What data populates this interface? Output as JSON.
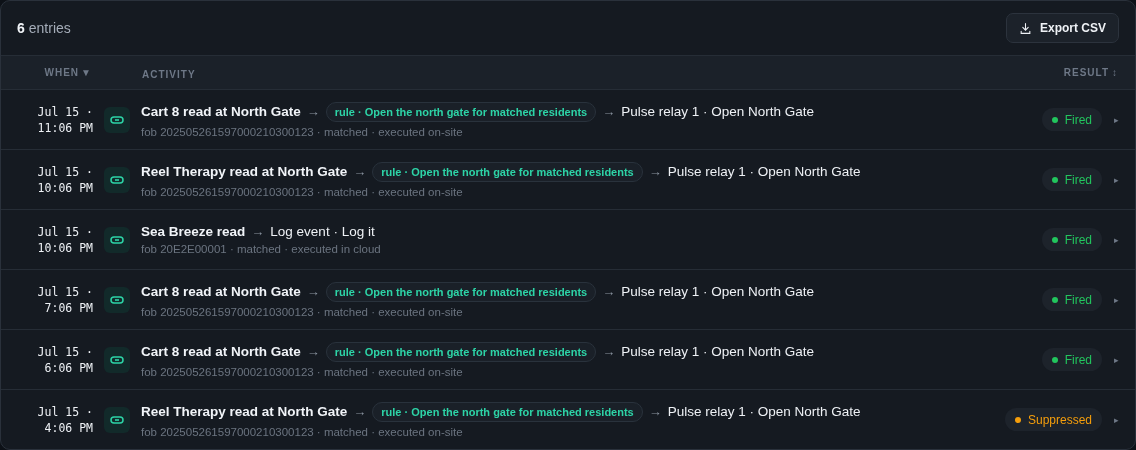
{
  "header": {
    "count": "6",
    "count_label": "entries",
    "export_button": "Export CSV"
  },
  "columns": {
    "when": "WHEN",
    "when_sort": "▼",
    "activity": "ACTIVITY",
    "result": "RESULT",
    "result_sort": "↕"
  },
  "rows": [
    {
      "date": "Jul 15 ·",
      "time": "11:06 PM",
      "trigger": "Cart 8 read at North Gate",
      "arrow": "→",
      "rule": "rule · Open the north gate for matched residents",
      "arrow_2": "→",
      "action": "Pulse relay 1 · Open North Gate",
      "meta": "fob 202505261597000210300123 · matched · executed on-site",
      "result": {
        "label": "Fired",
        "kind": "fired"
      },
      "expand": "▸"
    },
    {
      "date": "Jul 15 ·",
      "time": "10:06 PM",
      "trigger": "Reel Therapy read at North Gate",
      "arrow": "→",
      "rule": "rule · Open the north gate for matched residents",
      "arrow_2": "→",
      "action": "Pulse relay 1 · Open North Gate",
      "meta": "fob 202505261597000210300123 · matched · executed on-site",
      "result": {
        "label": "Fired",
        "kind": "fired"
      },
      "expand": "▸"
    },
    {
      "date": "Jul 15 ·",
      "time": "10:06 PM",
      "trigger": "Sea Breeze read",
      "arrow": "→",
      "action": "Log event · Log it",
      "meta": "fob 20E2E00001 · matched · executed in cloud",
      "result": {
        "label": "Fired",
        "kind": "fired"
      },
      "expand": "▸"
    },
    {
      "date": "Jul 15 ·",
      "time": "7:06 PM",
      "trigger": "Cart 8 read at North Gate",
      "arrow": "→",
      "rule": "rule · Open the north gate for matched residents",
      "arrow_2": "→",
      "action": "Pulse relay 1 · Open North Gate",
      "meta": "fob 202505261597000210300123 · matched · executed on-site",
      "result": {
        "label": "Fired",
        "kind": "fired"
      },
      "expand": "▸"
    },
    {
      "date": "Jul 15 ·",
      "time": "6:06 PM",
      "trigger": "Cart 8 read at North Gate",
      "arrow": "→",
      "rule": "rule · Open the north gate for matched residents",
      "arrow_2": "→",
      "action": "Pulse relay 1 · Open North Gate",
      "meta": "fob 202505261597000210300123 · matched · executed on-site",
      "result": {
        "label": "Fired",
        "kind": "fired"
      },
      "expand": "▸"
    },
    {
      "date": "Jul 15 ·",
      "time": "4:06 PM",
      "trigger": "Reel Therapy read at North Gate",
      "arrow": "→",
      "rule": "rule · Open the north gate for matched residents",
      "arrow_2": "→",
      "action": "Pulse relay 1 · Open North Gate",
      "meta": "fob 202505261597000210300123 · matched · executed on-site",
      "result": {
        "label": "Suppressed",
        "kind": "suppressed"
      },
      "expand": "▸"
    }
  ]
}
